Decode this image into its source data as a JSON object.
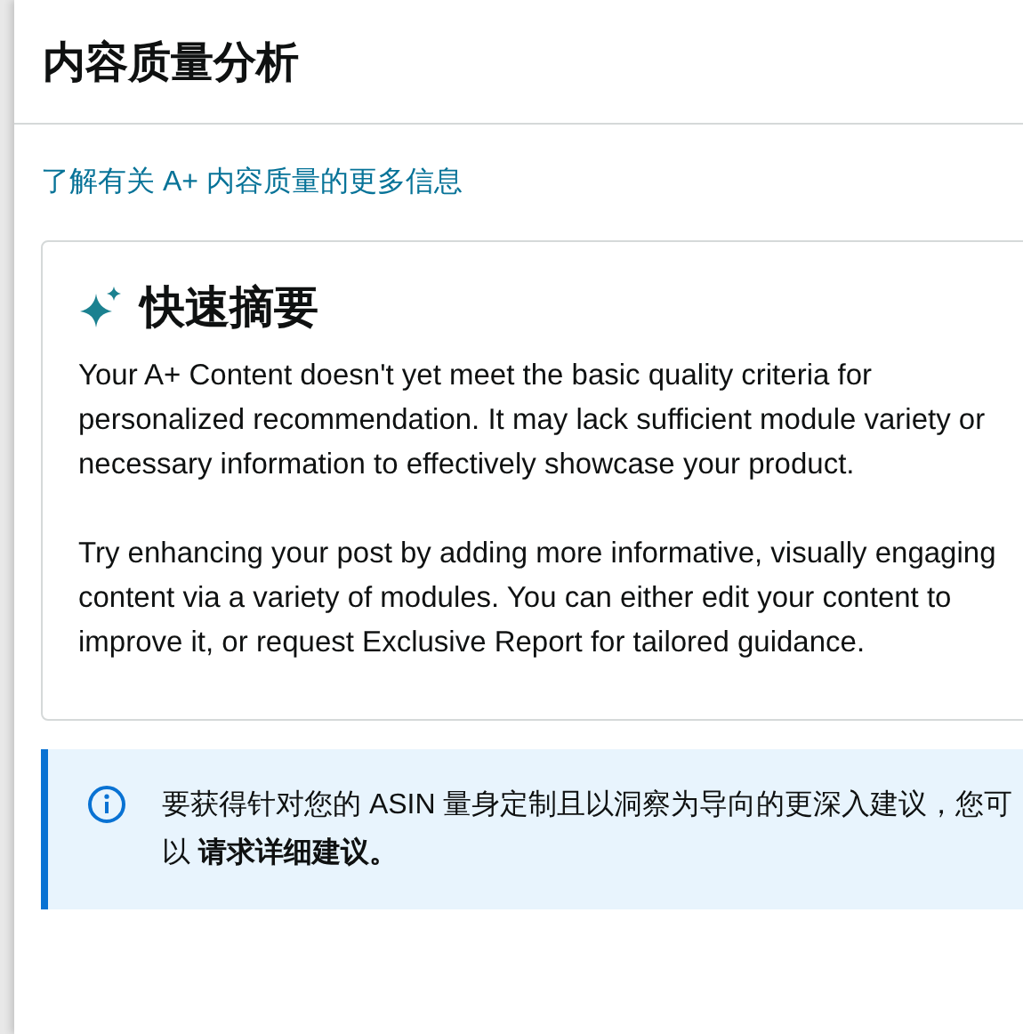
{
  "panel": {
    "title": "内容质量分析",
    "learn_more_link": "了解有关 A+ 内容质量的更多信息",
    "summary_card": {
      "heading": "快速摘要",
      "paragraphs": [
        "Your A+ Content doesn't yet meet the basic quality criteria for personalized recommendation. It may lack sufficient module variety or necessary information to effectively showcase your product.",
        "Try enhancing your post by adding more informative, visually engaging content via a variety of modules. You can either edit your content to improve it, or request Exclusive Report for tailored guidance."
      ]
    },
    "info_alert": {
      "text": "要获得针对您的 ASIN 量身定制且以洞察为导向的更深入建议，您可以 **请求详细建议。**"
    }
  }
}
